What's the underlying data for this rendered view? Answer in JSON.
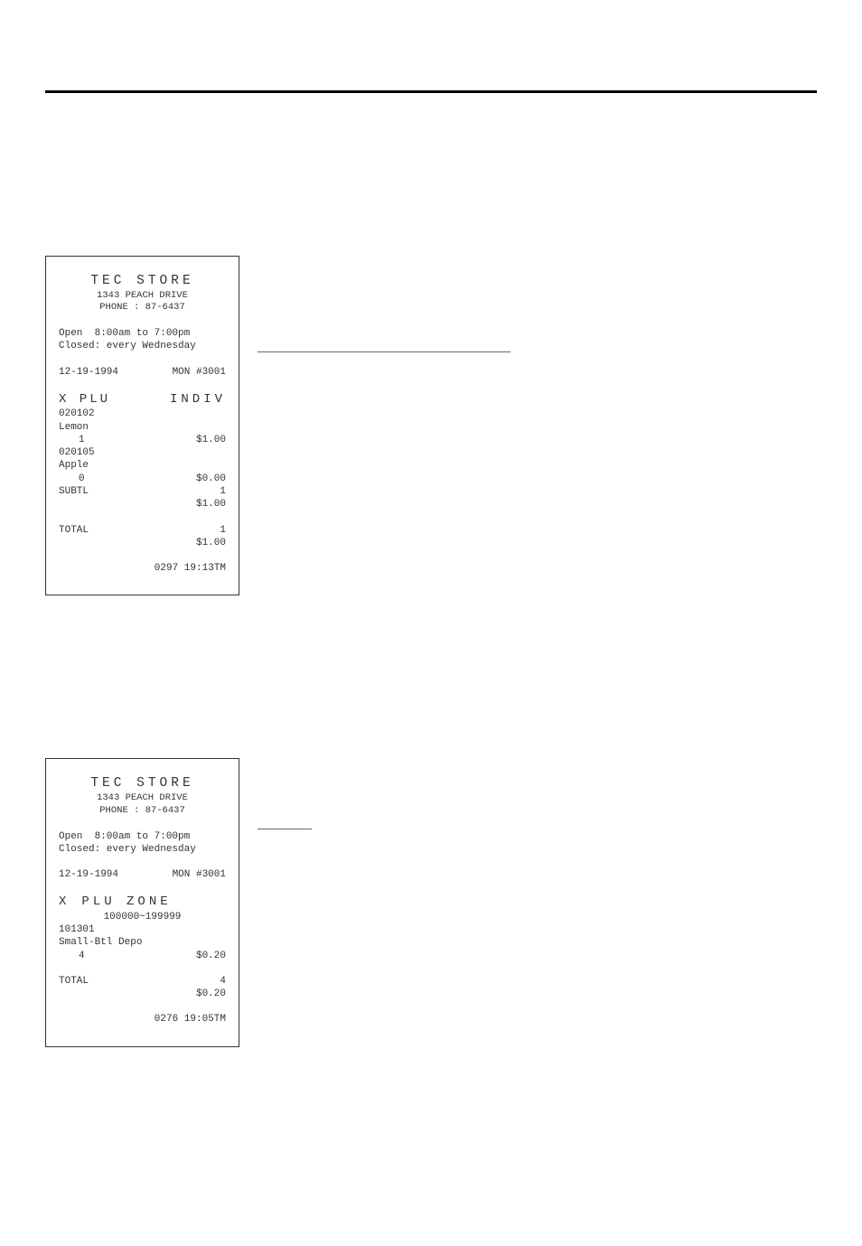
{
  "receipt1": {
    "store_name": "TEC STORE",
    "addr": "1343 PEACH DRIVE",
    "phone": "PHONE : 87-6437",
    "open": "Open  8:00am to 7:00pm",
    "closed": "Closed: every Wednesday",
    "date_line_left": "12-19-1994",
    "date_line_right": "MON #3001",
    "title_left": "X  PLU",
    "title_right": "INDIV",
    "items": [
      {
        "code": "020102",
        "name": "Lemon",
        "qty": "1",
        "amount": "$1.00"
      },
      {
        "code": "020105",
        "name": "Apple",
        "qty": "0",
        "amount": "$0.00"
      }
    ],
    "subtl_label": "SUBTL",
    "subtl_qty": "1",
    "subtl_amount": "$1.00",
    "total_label": "TOTAL",
    "total_qty": "1",
    "total_amount": "$1.00",
    "footer": "0297 19:13TM"
  },
  "receipt2": {
    "store_name": "TEC STORE",
    "addr": "1343 PEACH DRIVE",
    "phone": "PHONE : 87-6437",
    "open": "Open  8:00am to 7:00pm",
    "closed": "Closed: every Wednesday",
    "date_line_left": "12-19-1994",
    "date_line_right": "MON #3001",
    "title_left": "X",
    "title_right": "PLU ZONE",
    "range": "100000~199999",
    "item_code": "101301",
    "item_name": "Small-Btl Depo",
    "item_qty": "4",
    "item_amount": "$0.20",
    "total_label": "TOTAL",
    "total_qty": "4",
    "total_amount": "$0.20",
    "footer": "0276 19:05TM"
  }
}
